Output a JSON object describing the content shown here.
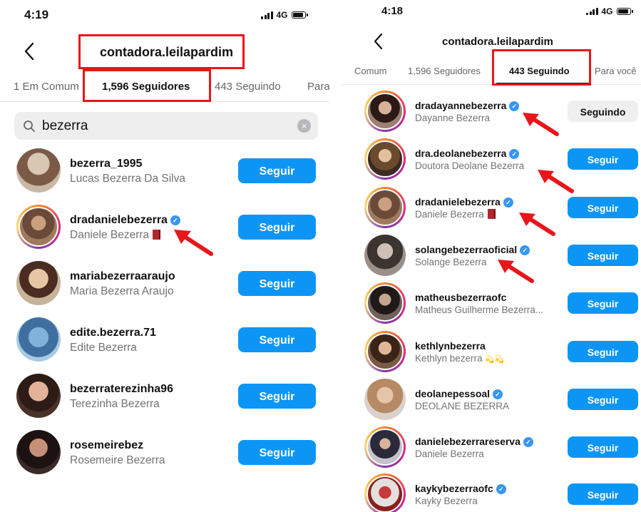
{
  "left": {
    "status": {
      "time": "4:19",
      "network": "4G"
    },
    "header": {
      "username": "contadora.leilapardim"
    },
    "tabs": [
      {
        "label": "1 Em Comum",
        "active": false
      },
      {
        "label": "1,596 Seguidores",
        "active": true
      },
      {
        "label": "443 Seguindo",
        "active": false
      },
      {
        "label": "Para",
        "active": false
      }
    ],
    "search": {
      "value": "bezerra",
      "clear_label": "×"
    },
    "users": [
      {
        "username": "bezerra_1995",
        "name": "Lucas Bezerra Da Silva",
        "verified": false,
        "emoji": "",
        "button": "Seguir"
      },
      {
        "username": "dradanielebezerra",
        "name": "Daniele Bezerra",
        "verified": true,
        "emoji": "book",
        "button": "Seguir"
      },
      {
        "username": "mariabezerraaraujo",
        "name": "Maria Bezerra Araujo",
        "verified": false,
        "emoji": "",
        "button": "Seguir"
      },
      {
        "username": "edite.bezerra.71",
        "name": "Edite Bezerra",
        "verified": false,
        "emoji": "",
        "button": "Seguir"
      },
      {
        "username": "bezerraterezinha96",
        "name": "Terezinha Bezerra",
        "verified": false,
        "emoji": "",
        "button": "Seguir"
      },
      {
        "username": "rosemeirebez",
        "name": "Rosemeire Bezerra",
        "verified": false,
        "emoji": "",
        "button": "Seguir"
      }
    ]
  },
  "right": {
    "status": {
      "time": "4:18",
      "network": "4G"
    },
    "header": {
      "username": "contadora.leilapardim"
    },
    "tabs": [
      {
        "label": "Comum",
        "active": false
      },
      {
        "label": "1,596 Seguidores",
        "active": false
      },
      {
        "label": "443 Seguindo",
        "active": true
      },
      {
        "label": "Para você",
        "active": false
      }
    ],
    "users": [
      {
        "username": "dradayannebezerra",
        "name": "Dayanne Bezerra",
        "verified": true,
        "emoji": "",
        "button": "Seguindo"
      },
      {
        "username": "dra.deolanebezerra",
        "name": "Doutora Deolane Bezerra",
        "verified": true,
        "emoji": "",
        "button": "Seguir"
      },
      {
        "username": "dradanielebezerra",
        "name": "Daniele Bezerra",
        "verified": true,
        "emoji": "book",
        "button": "Seguir"
      },
      {
        "username": "solangebezerraoficial",
        "name": "Solange Bezerra",
        "verified": true,
        "emoji": "",
        "button": "Seguir"
      },
      {
        "username": "matheusbezerraofc",
        "name": "Matheus Guilherme Bezerra...",
        "verified": false,
        "emoji": "",
        "button": "Seguir"
      },
      {
        "username": "kethlynbezerra",
        "name": "Kethlyn bezerra",
        "verified": false,
        "emoji": "sparkles",
        "button": "Seguir"
      },
      {
        "username": "deolanepessoal",
        "name": "DEOLANE BEZERRA",
        "verified": true,
        "emoji": "",
        "button": "Seguir"
      },
      {
        "username": "danielebezerrareserva",
        "name": "Daniele Bezerra",
        "verified": true,
        "emoji": "",
        "button": "Seguir"
      },
      {
        "username": "kaykybezerraofc",
        "name": "Kayky Bezerra",
        "verified": true,
        "emoji": "",
        "button": "Seguir"
      }
    ]
  },
  "icons": {
    "verified": "✓",
    "sparkle": "💫💫"
  },
  "colors": {
    "follow_button": "#0d95f6",
    "annotation_red": "#e8161b",
    "verified_blue": "#3897f0"
  }
}
